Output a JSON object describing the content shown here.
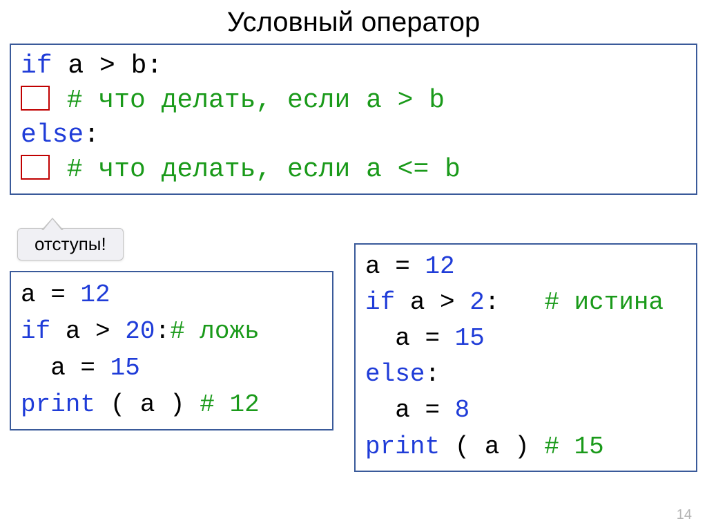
{
  "title": "Условный оператор",
  "callout_label": "отступы!",
  "top": {
    "l1_if": "if",
    "l1_cond": " a > b:",
    "l2_comment": " # что делать, если a > b",
    "l3_else": "else",
    "l3_colon": ":",
    "l4_comment": " # что делать, если a <= b"
  },
  "left": {
    "l1_pre": "a = ",
    "l1_num": "12",
    "l2_if": "if",
    "l2_mid": " a > ",
    "l2_num": "20",
    "l2_colon": ":",
    "l2_comment": "# ложь",
    "l3_pre": "  a = ",
    "l3_num": "15",
    "l4_print": "print",
    "l4_mid": " ( a ) ",
    "l4_comment": "# 12"
  },
  "right": {
    "l1_pre": "a = ",
    "l1_num": "12",
    "l2_if": "if",
    "l2_mid": " a > ",
    "l2_num": "2",
    "l2_colon": ":   ",
    "l2_comment": "# истина",
    "l3_pre": "  a = ",
    "l3_num": "15",
    "l4_else": "else",
    "l4_colon": ":",
    "l5_pre": "  a = ",
    "l5_num": "8",
    "l6_print": "print",
    "l6_mid": " ( a ) ",
    "l6_comment": "# 15"
  },
  "page_number": "14"
}
